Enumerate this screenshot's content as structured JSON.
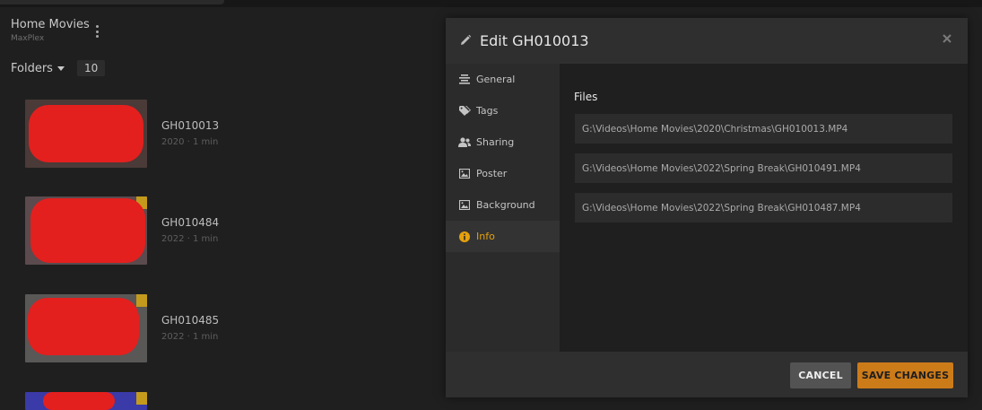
{
  "library": {
    "title": "Home Movies",
    "server": "MaxPlex",
    "folders_label": "Folders",
    "folder_count": "10",
    "items": [
      {
        "title": "GH010013",
        "meta": "2020 · 1 min"
      },
      {
        "title": "GH010484",
        "meta": "2022 · 1 min"
      },
      {
        "title": "GH010485",
        "meta": "2022 · 1 min"
      }
    ]
  },
  "modal": {
    "title": "Edit GH010013",
    "tabs": [
      {
        "label": "General",
        "icon": "list-icon"
      },
      {
        "label": "Tags",
        "icon": "tag-icon"
      },
      {
        "label": "Sharing",
        "icon": "users-icon"
      },
      {
        "label": "Poster",
        "icon": "image-icon"
      },
      {
        "label": "Background",
        "icon": "image-icon"
      },
      {
        "label": "Info",
        "icon": "info-icon"
      }
    ],
    "active_tab": "Info",
    "files_heading": "Files",
    "files": [
      "G:\\Videos\\Home Movies\\2020\\Christmas\\GH010013.MP4",
      "G:\\Videos\\Home Movies\\2022\\Spring Break\\GH010491.MP4",
      "G:\\Videos\\Home Movies\\2022\\Spring Break\\GH010487.MP4"
    ],
    "cancel_label": "CANCEL",
    "save_label": "SAVE CHANGES"
  },
  "colors": {
    "accent": "#e5a00d",
    "save_button": "#cc7b19",
    "redaction": "#e3201e"
  }
}
